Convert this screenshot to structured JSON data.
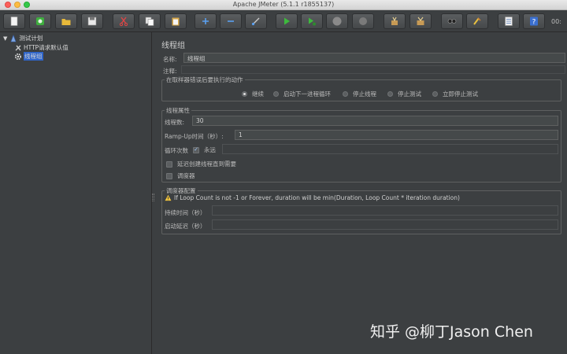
{
  "window": {
    "title": "Apache JMeter (5.1.1 r1855137)",
    "timer": "00:"
  },
  "toolbar": {
    "buttons": [
      {
        "name": "new-icon"
      },
      {
        "name": "templates-icon"
      },
      {
        "name": "open-icon"
      },
      {
        "name": "save-icon"
      },
      {
        "name": "cut-icon"
      },
      {
        "name": "copy-icon"
      },
      {
        "name": "paste-icon"
      },
      {
        "name": "expand-icon"
      },
      {
        "name": "collapse-icon"
      },
      {
        "name": "toggle-icon"
      },
      {
        "name": "start-icon"
      },
      {
        "name": "start-no-pauses-icon"
      },
      {
        "name": "stop-icon"
      },
      {
        "name": "shutdown-icon"
      },
      {
        "name": "clear-icon"
      },
      {
        "name": "clear-all-icon"
      },
      {
        "name": "search-icon"
      },
      {
        "name": "reset-search-icon"
      },
      {
        "name": "function-helper-icon"
      },
      {
        "name": "help-icon"
      }
    ],
    "help_glyph": "?"
  },
  "tree": {
    "items": [
      {
        "label": "测试计划",
        "icon": "test-plan-icon"
      },
      {
        "label": "HTTP请求默认值",
        "icon": "config-element-icon"
      },
      {
        "label": "线程组",
        "icon": "thread-group-icon",
        "selected": true
      }
    ]
  },
  "panel": {
    "title": "线程组",
    "name_label": "名称:",
    "name_value": "线程组",
    "comment_label": "注释:",
    "comment_value": "",
    "error_action": {
      "title": "在取样器错误后要执行的动作",
      "options": [
        {
          "label": "继续",
          "selected": true
        },
        {
          "label": "启动下一进程循环",
          "selected": false
        },
        {
          "label": "停止线程",
          "selected": false
        },
        {
          "label": "停止测试",
          "selected": false
        },
        {
          "label": "立即停止测试",
          "selected": false
        }
      ]
    },
    "thread_props": {
      "title": "线程属性",
      "threads_label": "线程数:",
      "threads_value": "30",
      "rampup_label": "Ramp-Up时间（秒）:",
      "rampup_value": "1",
      "loop_label": "循环次数",
      "forever_label": "永远",
      "forever_checked": true,
      "loop_value": "",
      "delay_label": "延迟创建线程直到需要",
      "delay_checked": false,
      "scheduler_label": "调度器",
      "scheduler_checked": false
    },
    "scheduler": {
      "title": "调度器配置",
      "warning": "If Loop Count is not -1 or Forever, duration will be min(Duration, Loop Count * iteration duration)",
      "duration_label": "持续时间（秒）",
      "duration_value": "",
      "delay_label": "启动延迟（秒）",
      "delay_value": ""
    }
  },
  "watermark": "知乎 @柳丁Jason Chen"
}
